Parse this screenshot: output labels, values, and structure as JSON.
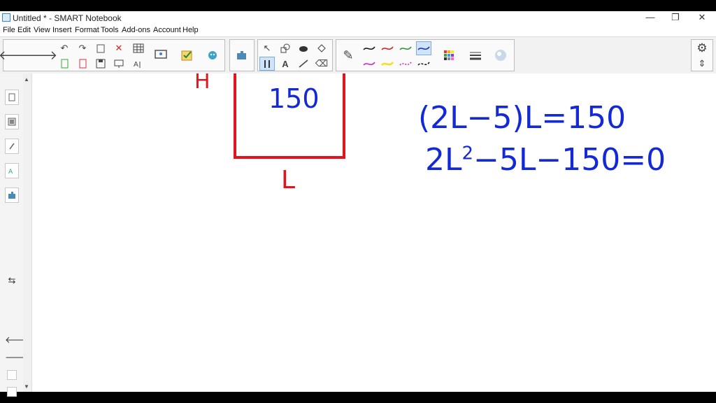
{
  "window": {
    "title": "Untitled * - SMART Notebook",
    "controls": {
      "minimize": "—",
      "restore": "❐",
      "close": "✕"
    }
  },
  "menu": [
    "File",
    "Edit",
    "View",
    "Insert",
    "Format",
    "Tools",
    "Add-ons",
    "Account",
    "Help"
  ],
  "icons": {
    "back": "🡐",
    "forward": "🡒",
    "undo": "↶",
    "redo": "↷",
    "delete": "✕",
    "select": "↖",
    "text": "A",
    "pen": "✎",
    "eraser": "⌫",
    "gear": "⚙",
    "expand": "⇕"
  },
  "colors": {
    "ink_blue": "#1429d6",
    "ink_red": "#e3141b",
    "selected_tool": "#cfe4fb"
  },
  "canvas": {
    "diagram": {
      "area_label": "150",
      "side_left_label": "H",
      "side_bottom_label": "L"
    },
    "equations": {
      "partial_line": "−",
      "line1": "(2L−5)L=150",
      "line2_prefix": "2L",
      "line2_exponent": "2",
      "line2_suffix": "−5L−150=0"
    }
  }
}
